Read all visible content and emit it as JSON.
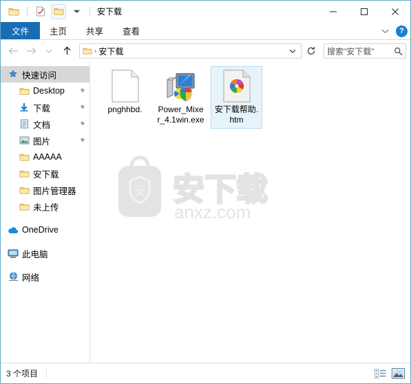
{
  "window": {
    "title": "安下载",
    "accent_color": "#1a6cb5",
    "border_color": "#5aa8c8"
  },
  "titlebar": {
    "app_icon": "folder-icon",
    "qat": [
      {
        "name": "properties-icon",
        "label": "属性"
      },
      {
        "name": "new-folder-icon",
        "label": "新建文件夹"
      }
    ],
    "dropdown_icon": "chevron-down-icon",
    "caption": {
      "minimize": "minimize-icon",
      "maximize": "maximize-icon",
      "close": "close-icon"
    }
  },
  "ribbon": {
    "tabs": [
      {
        "label": "文件",
        "active": true
      },
      {
        "label": "主页",
        "active": false
      },
      {
        "label": "共享",
        "active": false
      },
      {
        "label": "查看",
        "active": false
      }
    ],
    "collapse_icon": "chevron-down-icon",
    "help_label": "?"
  },
  "addressbar": {
    "back_icon": "arrow-left-icon",
    "forward_icon": "arrow-right-icon",
    "recent_icon": "chevron-down-icon",
    "up_icon": "arrow-up-icon",
    "breadcrumb": {
      "folder_icon": "folder-icon",
      "label": "安下载",
      "separator": "›"
    },
    "dropdown_icon": "chevron-down-icon",
    "refresh_icon": "refresh-icon",
    "search": {
      "placeholder": "搜索\"安下载\"",
      "icon": "search-icon"
    }
  },
  "sidebar": {
    "items": [
      {
        "label": "快速访问",
        "icon": "star-pin-icon",
        "level": 0,
        "selected": true,
        "pinned": false
      },
      {
        "label": "Desktop",
        "icon": "folder-icon",
        "level": 1,
        "selected": false,
        "pinned": true
      },
      {
        "label": "下载",
        "icon": "download-icon",
        "level": 1,
        "selected": false,
        "pinned": true
      },
      {
        "label": "文档",
        "icon": "documents-icon",
        "level": 1,
        "selected": false,
        "pinned": true
      },
      {
        "label": "图片",
        "icon": "pictures-icon",
        "level": 1,
        "selected": false,
        "pinned": true
      },
      {
        "label": "AAAAA",
        "icon": "folder-icon",
        "level": 1,
        "selected": false,
        "pinned": false
      },
      {
        "label": "安下载",
        "icon": "folder-icon",
        "level": 1,
        "selected": false,
        "pinned": false
      },
      {
        "label": "图片管理器",
        "icon": "folder-icon",
        "level": 1,
        "selected": false,
        "pinned": false
      },
      {
        "label": "未上传",
        "icon": "folder-icon",
        "level": 1,
        "selected": false,
        "pinned": false
      },
      {
        "label": "OneDrive",
        "icon": "cloud-icon",
        "level": 0,
        "selected": false,
        "pinned": false,
        "gap_before": true
      },
      {
        "label": "此电脑",
        "icon": "computer-icon",
        "level": 0,
        "selected": false,
        "pinned": false,
        "gap_before": true
      },
      {
        "label": "网络",
        "icon": "network-icon",
        "level": 0,
        "selected": false,
        "pinned": false,
        "gap_before": true
      }
    ]
  },
  "files": [
    {
      "name": "pnghhbd.",
      "icon": "blank-document-icon",
      "selected": false
    },
    {
      "name": "Power_Mixer_4.1win.exe",
      "icon": "application-exe-icon",
      "selected": false
    },
    {
      "name": "安下载帮助.htm",
      "icon": "html-document-icon",
      "selected": true
    }
  ],
  "watermark": {
    "logo_text": "安",
    "brand": "安下载",
    "domain": "anxz.com",
    "color": "#e2e2e2"
  },
  "statusbar": {
    "item_count_text": "3 个项目",
    "views": [
      {
        "name": "details-view-button",
        "active": false
      },
      {
        "name": "large-icons-view-button",
        "active": true
      }
    ]
  }
}
